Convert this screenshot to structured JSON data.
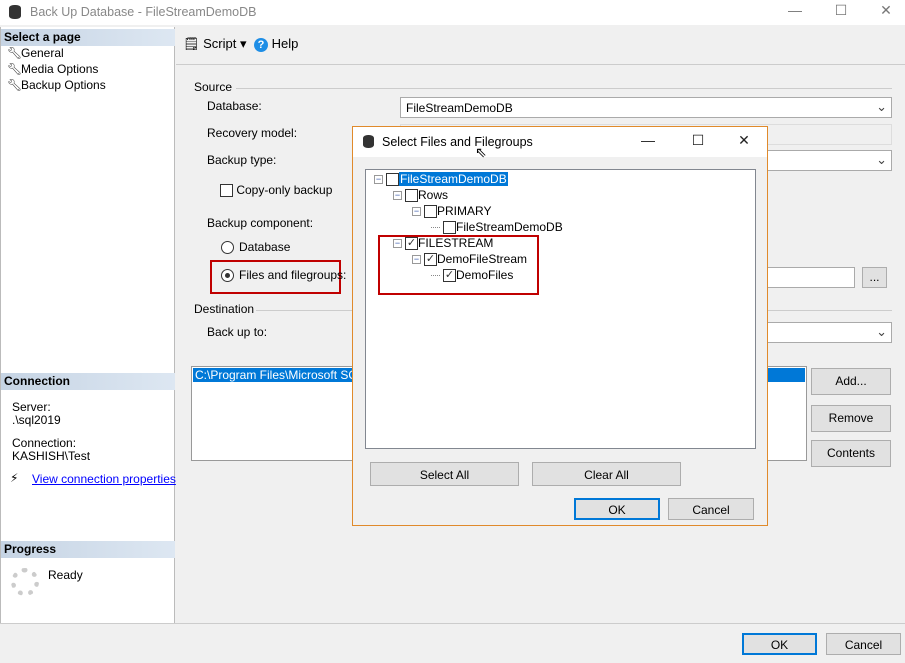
{
  "window": {
    "title": "Back Up Database - FileStreamDemoDB",
    "minimize": "—",
    "maximize": "☐",
    "close": "✕"
  },
  "sidebar": {
    "header": "Select a page",
    "items": [
      {
        "label": "General"
      },
      {
        "label": "Media Options"
      },
      {
        "label": "Backup Options"
      }
    ],
    "connection": {
      "header": "Connection",
      "server_label": "Server:",
      "server": ".\\sql2019",
      "connection_label": "Connection:",
      "connection": "KASHISH\\Test",
      "link": "View connection properties"
    },
    "progress": {
      "header": "Progress",
      "status": "Ready"
    }
  },
  "toolbar": {
    "script": "Script",
    "help": "Help"
  },
  "form": {
    "source": "Source",
    "database_label": "Database:",
    "database": "FileStreamDemoDB",
    "recovery_label": "Recovery model:",
    "backup_type_label": "Backup type:",
    "copy_only": "Copy-only backup",
    "component_label": "Backup component:",
    "radio_database": "Database",
    "radio_files": "Files and filegroups:",
    "browse": "...",
    "destination": "Destination",
    "backup_to_label": "Back up to:",
    "destinations": [
      "C:\\Program Files\\Microsoft SQL S"
    ],
    "add": "Add...",
    "remove": "Remove",
    "contents": "Contents"
  },
  "footer": {
    "ok": "OK",
    "cancel": "Cancel"
  },
  "dialog": {
    "title": "Select Files and Filegroups",
    "tree": [
      {
        "label": "FileStreamDemoDB",
        "level": 0,
        "checked": false,
        "expander": true,
        "selected": true
      },
      {
        "label": "Rows",
        "level": 1,
        "checked": false,
        "expander": true
      },
      {
        "label": "PRIMARY",
        "level": 2,
        "checked": false,
        "expander": true
      },
      {
        "label": "FileStreamDemoDB",
        "level": 3,
        "checked": false,
        "expander": false
      },
      {
        "label": "FILESTREAM",
        "level": 1,
        "checked": true,
        "expander": true
      },
      {
        "label": "DemoFileStream",
        "level": 2,
        "checked": true,
        "expander": true
      },
      {
        "label": "DemoFiles",
        "level": 3,
        "checked": true,
        "expander": false
      }
    ],
    "select_all": "Select All",
    "clear_all": "Clear All",
    "ok": "OK",
    "cancel": "Cancel"
  },
  "colors": {
    "accent": "#0078d7",
    "highlight_box": "#c00000",
    "dialog_border": "#e08a2b"
  }
}
